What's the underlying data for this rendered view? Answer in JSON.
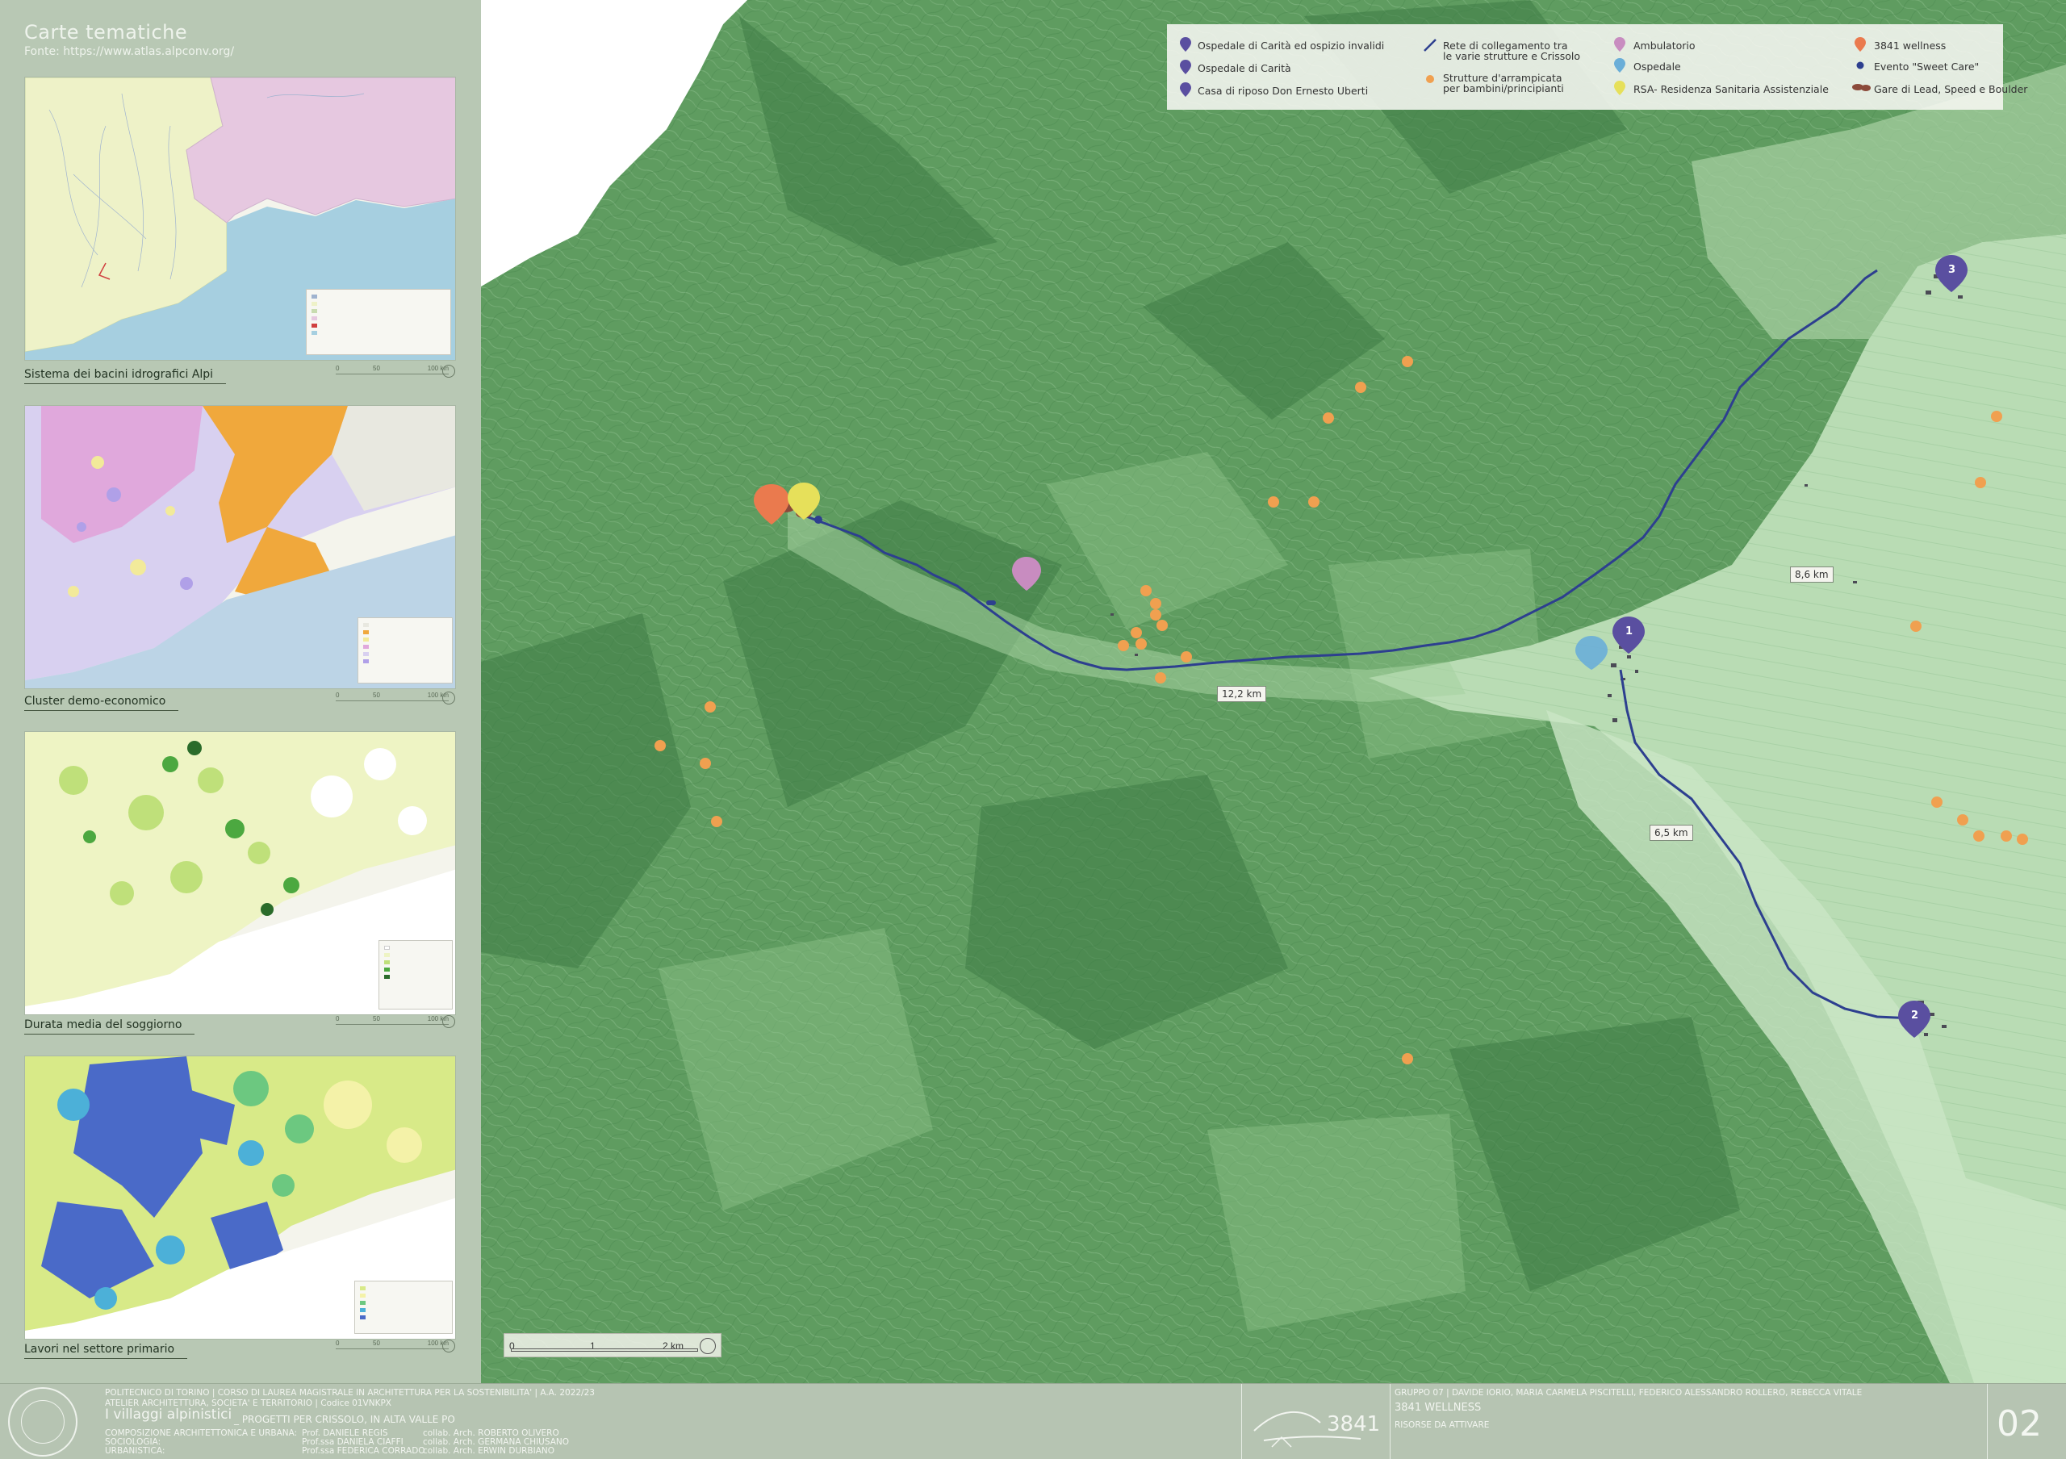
{
  "sidebar": {
    "title": "Carte tematiche",
    "source": "Fonte: https://www.atlas.alpconv.org/",
    "maps": [
      {
        "caption": "Sistema dei bacini idrografici Alpi"
      },
      {
        "caption": "Cluster demo-economico"
      },
      {
        "caption": "Durata media del soggiorno"
      },
      {
        "caption": "Lavori nel settore primario"
      }
    ],
    "thumb_scale": [
      "0",
      "50",
      "100 km"
    ]
  },
  "legend": {
    "items": [
      {
        "icon": "pin-violet-1-icon",
        "label": "Ospedale di Carità ed ospizio invalidi"
      },
      {
        "icon": "pin-violet-2-icon",
        "label": "Ospedale di Carità"
      },
      {
        "icon": "pin-violet-3-icon",
        "label": "Casa di riposo Don Ernesto Uberti"
      },
      {
        "icon": "route-line-icon",
        "label": "Rete di collegamento tra\nle varie strutture e Crissolo"
      },
      {
        "icon": "orange-dot-icon",
        "label": "Strutture d'arrampicata\nper bambini/principianti"
      },
      {
        "icon": "pin-pink-icon",
        "label": "Ambulatorio"
      },
      {
        "icon": "pin-lightblue-icon",
        "label": "Ospedale"
      },
      {
        "icon": "pin-yellow-icon",
        "label": "RSA- Residenza Sanitaria Assistenziale"
      },
      {
        "icon": "pin-orange-icon",
        "label": "3841 wellness"
      },
      {
        "icon": "blue-dot-icon",
        "label": "Evento \"Sweet Care\""
      },
      {
        "icon": "brown-shape-icon",
        "label": "Gare di Lead, Speed e Boulder"
      }
    ]
  },
  "map": {
    "distances": [
      "12,2 km",
      "8,6 km",
      "6,5 km"
    ],
    "pins": [
      "1",
      "2",
      "3"
    ],
    "scale": {
      "labels": [
        "0",
        "1",
        "2 km"
      ]
    }
  },
  "footer": {
    "line1": "POLITECNICO DI TORINO   |   CORSO DI LAUREA MAGISTRALE IN ARCHITETTURA PER LA SOSTENIBILITA'   |   A.A. 2022/23",
    "line2": "ATELIER ARCHITETTURA, SOCIETA' E TERRITORIO   |   Codice 01VNKPX",
    "title_main": "I villaggi alpinistici",
    "title_sub": "_ PROGETTI PER CRISSOLO, IN ALTA VALLE PO",
    "courses": [
      "COMPOSIZIONE ARCHITETTONICA E URBANA:",
      "SOCIOLOGIA:",
      "URBANISTICA:"
    ],
    "profs": [
      "Prof.     DANIELE REGIS",
      "Prof.ssa DANIELA CIAFFI",
      "Prof.ssa FEDERICA CORRADO"
    ],
    "collabs": [
      "collab. Arch. ROBERTO OLIVERO",
      "collab. Arch. GERMANA CHIUSANO",
      "collab. Arch. ERWIN DURBIANO"
    ],
    "logo_text": "3841",
    "group": "GRUPPO 07  |  DAVIDE IORIO, MARIA CARMELA PISCITELLI, FEDERICO ALESSANDRO ROLLERO, REBECCA VITALE",
    "project": "3841 WELLNESS",
    "subtitle": "RISORSE DA ATTIVARE",
    "page": "02"
  },
  "colors": {
    "sidebar_bg": "#b8c8b4",
    "terrain_dark": "#4f8f55",
    "terrain_mid": "#6fa66f",
    "valley_light": "#b9dcb4",
    "route": "#2d3f8f",
    "climb_orange": "#f0a050",
    "pin_violet": "#5a4fa0",
    "pin_orange": "#ea7a4e",
    "pin_yellow": "#e6e05a",
    "pin_pink": "#c88cc0",
    "pin_lightblue": "#6aaed8"
  }
}
